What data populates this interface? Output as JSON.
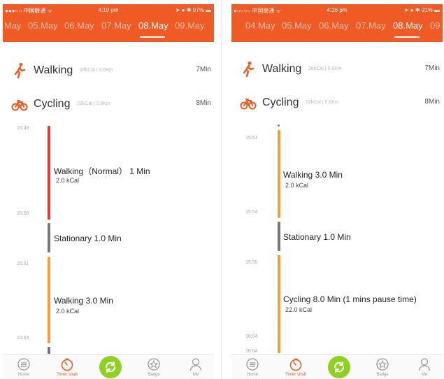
{
  "colors": {
    "accent": "#f05a24",
    "red": "#e53935",
    "gray": "#777777",
    "orange": "#f2a03d",
    "green": "#8fd121"
  },
  "left": {
    "status": {
      "carrier": "●●●○○ 中国联通 ᯤ",
      "time": "4:10 pm",
      "right": "➤ ● ✱ 97% ▬"
    },
    "dates": [
      "May",
      "05.May",
      "06.May",
      "07.May",
      "08.May",
      "09.May"
    ],
    "summary": [
      {
        "name": "Walking",
        "sub": "26kCal | 0.6Km",
        "duration": "7Min",
        "icon": "walking-icon"
      },
      {
        "name": "Cycling",
        "sub": "22kCal | 0.6Km",
        "duration": "8Min",
        "icon": "cycling-icon"
      }
    ],
    "timeline_times": [
      "15:49",
      "15:50",
      "15:51",
      "15:54"
    ],
    "activities": [
      {
        "title": "Walking（Normal）  1 Min",
        "sub": "2.0 kCal"
      },
      {
        "title": "Stationary 1.0 Min",
        "sub": ""
      },
      {
        "title": "Walking 3.0 Min",
        "sub": "2.0 kCal"
      }
    ]
  },
  "right": {
    "status": {
      "carrier": "●○○○○ 中国联通 ᯤ",
      "time": "4:26 pm",
      "right": "➤ ● ✱ 91% ▬"
    },
    "dates": [
      "04.May",
      "05.May",
      "06.May",
      "07.May",
      "08.May",
      "09"
    ],
    "summary": [
      {
        "name": "Walking",
        "sub": "26kCal | 0.6Km",
        "duration": "7Min",
        "icon": "walking-icon"
      },
      {
        "name": "Cycling",
        "sub": "22kCal | 0.6Km",
        "duration": "8Min",
        "icon": "cycling-icon"
      }
    ],
    "timeline_times": [
      "15:51",
      "15:54",
      "15:55",
      "16:04",
      "16:04"
    ],
    "activities": [
      {
        "title": "Walking 3.0 Min",
        "sub": "2.0 kCal"
      },
      {
        "title": "Stationary 1.0 Min",
        "sub": ""
      },
      {
        "title": "Cycling 8.0 Min   (1 mins pause time)",
        "sub": "22.0 kCal"
      }
    ]
  },
  "tabs": [
    "Home",
    "Timer shaft",
    "",
    "Badge",
    "Me"
  ]
}
